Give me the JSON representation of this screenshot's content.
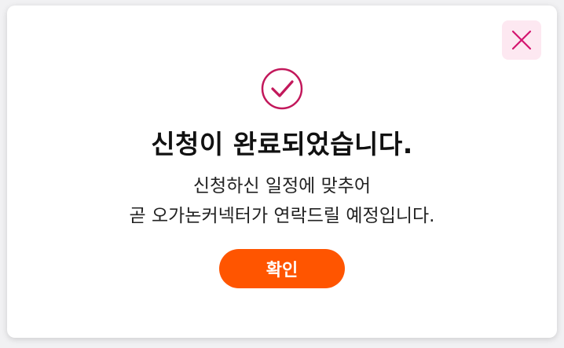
{
  "dialog": {
    "title": "신청이 완료되었습니다.",
    "message_line1": "신청하신 일정에 맞추어",
    "message_line2": "곧 오가논커넥터가 연락드릴 예정입니다.",
    "confirm_label": "확인",
    "icons": {
      "success": "check-circle-icon",
      "close": "close-icon"
    }
  },
  "colors": {
    "accent": "#c2185b",
    "close_bg": "#fde8f1",
    "button": "#ff5500"
  }
}
